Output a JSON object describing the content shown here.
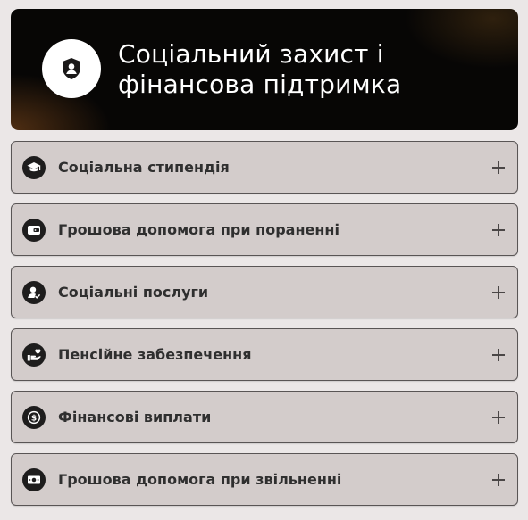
{
  "hero": {
    "title_line1": "Соціальний захист і",
    "title_line2": "фінансова підтримка",
    "icon": "shield-user-icon"
  },
  "accordion": {
    "items": [
      {
        "label": "Соціальна стипендія",
        "icon": "graduation-cap-icon"
      },
      {
        "label": "Грошова допомога при пораненні",
        "icon": "wallet-icon"
      },
      {
        "label": "Соціальні послуги",
        "icon": "user-check-icon"
      },
      {
        "label": "Пенсійне забезпечення",
        "icon": "hand-heart-icon"
      },
      {
        "label": "Фінансові виплати",
        "icon": "coin-dollar-icon"
      },
      {
        "label": "Грошова допомога при звільненні",
        "icon": "banknote-icon"
      }
    ]
  },
  "colors": {
    "page_background": "#ebe7e7",
    "hero_background": "#070605",
    "item_background": "#d3cccb",
    "item_border": "#595555",
    "icon_circle": "#1e1d1d",
    "text": "#2f2f2f"
  }
}
